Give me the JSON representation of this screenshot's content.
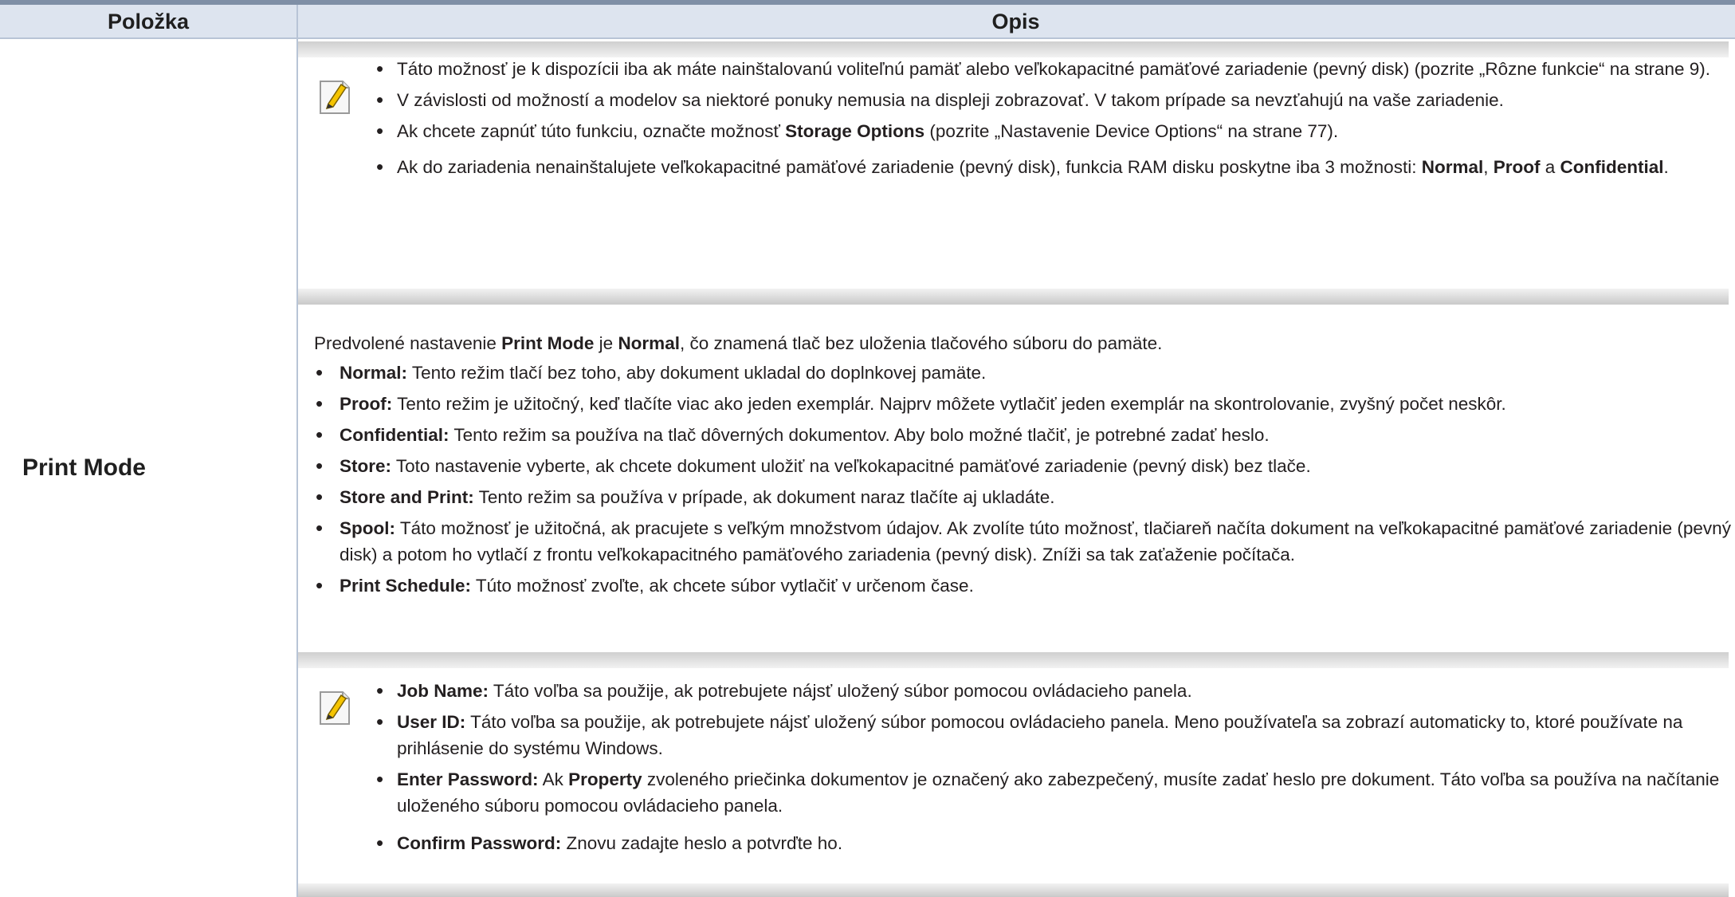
{
  "header": {
    "col_item": "Položka",
    "col_description": "Opis"
  },
  "row": {
    "item_label": "Print Mode"
  },
  "note1": {
    "icon": "note-pencil-icon",
    "b1": "Táto možnosť je k dispozícii iba ak máte nainštalovanú voliteľnú pamäť alebo veľkokapacitné pamäťové zariadenie (pevný disk) (pozrite „Rôzne funkcie“ na strane 9).",
    "b2": "V závislosti od možností a modelov sa niektoré ponuky nemusia na displeji zobrazovať. V takom prípade sa nevzťahujú na vaše zariadenie.",
    "b3_pre": "Ak chcete zapnúť túto funkciu, označte možnosť ",
    "b3_bold": "Storage Options",
    "b3_post": " (pozrite „Nastavenie Device Options“ na strane 77).",
    "b4_pre": "Ak do zariadenia nenainštalujete veľkokapacitné pamäťové zariadenie (pevný disk), funkcia RAM disku poskytne iba 3 možnosti: ",
    "b4_normal": "Normal",
    "b4_comma": ",",
    "b4_proof": "Proof",
    "b4_and": " a ",
    "b4_conf": "Confidential",
    "b4_end": "."
  },
  "intro": {
    "pre": "Predvolené nastavenie ",
    "bold1": "Print Mode",
    "mid": " je ",
    "bold2": "Normal",
    "post": ", čo znamená tlač bez uloženia tlačového súboru do pamäte."
  },
  "modes": [
    {
      "name": "Normal:",
      "text": " Tento režim tlačí bez toho, aby dokument ukladal do doplnkovej pamäte."
    },
    {
      "name": "Proof:",
      "text": " Tento režim je užitočný, keď tlačíte viac ako jeden exemplár. Najprv môžete vytlačiť jeden exemplár na skontrolovanie, zvyšný počet neskôr."
    },
    {
      "name": "Confidential:",
      "text": " Tento režim sa používa na tlač dôverných dokumentov. Aby bolo možné tlačiť, je potrebné zadať heslo."
    },
    {
      "name": "Store:",
      "text": " Toto nastavenie vyberte, ak chcete dokument uložiť na veľkokapacitné pamäťové zariadenie (pevný disk) bez tlače."
    },
    {
      "name": "Store and Print:",
      "text": " Tento režim sa používa v prípade, ak dokument naraz tlačíte aj ukladáte."
    },
    {
      "name": "Spool:",
      "text": " Táto možnosť je užitočná, ak pracujete s veľkým množstvom údajov. Ak zvolíte túto možnosť, tlačiareň načíta dokument na veľkokapacitné pamäťové zariadenie (pevný disk) a potom ho vytlačí z frontu veľkokapacitného pamäťového zariadenia (pevný disk). Zníži sa tak zaťaženie počítača."
    },
    {
      "name": "Print Schedule:",
      "text": " Túto možnosť zvoľte, ak chcete súbor vytlačiť v určenom čase."
    }
  ],
  "note2": {
    "icon": "note-pencil-icon",
    "items": [
      {
        "name": "Job Name:",
        "text": " Táto voľba sa použije, ak potrebujete nájsť uložený súbor pomocou ovládacieho panela."
      },
      {
        "name": "User ID:",
        "text": " Táto voľba sa použije, ak potrebujete nájsť uložený súbor pomocou ovládacieho panela. Meno používateľa sa zobrazí automaticky to, ktoré používate na prihlásenie do systému Windows."
      },
      {
        "name": "Enter Password:",
        "text_pre": " Ak ",
        "bold_mid": "Property",
        "text": " zvoleného priečinka dokumentov je označený ako zabezpečený, musíte zadať heslo pre dokument. Táto voľba sa používa na načítanie uloženého súboru pomocou ovládacieho panela."
      },
      {
        "name": "Confirm Password:",
        "text": " Znovu zadajte heslo a potvrďte ho."
      }
    ]
  }
}
